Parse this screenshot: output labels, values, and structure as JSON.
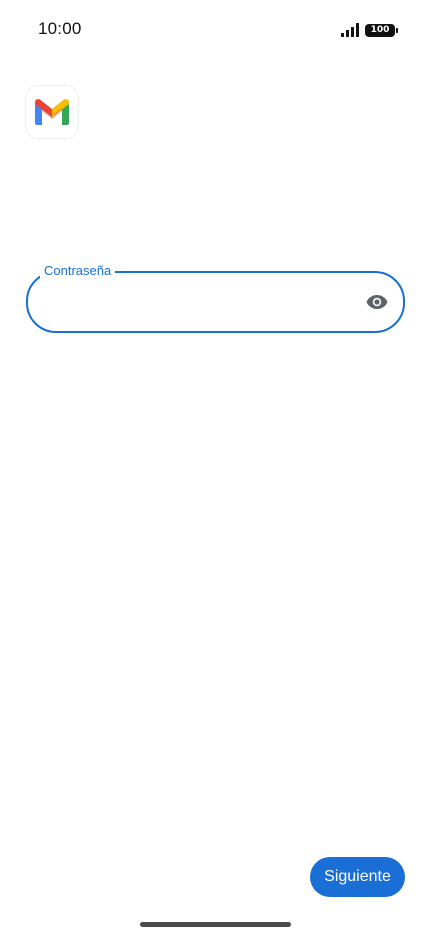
{
  "status_bar": {
    "time": "10:00",
    "signal_icon": "signal-bars-icon",
    "battery_level": "100"
  },
  "app": {
    "logo_icon": "gmail-logo-icon"
  },
  "password_field": {
    "label": "Contraseña",
    "value": "",
    "visibility_icon": "eye-icon"
  },
  "actions": {
    "next_label": "Siguiente"
  },
  "colors": {
    "accent": "#1a6fd6",
    "icon_gray": "#5f6368",
    "background": "#ffffff"
  }
}
